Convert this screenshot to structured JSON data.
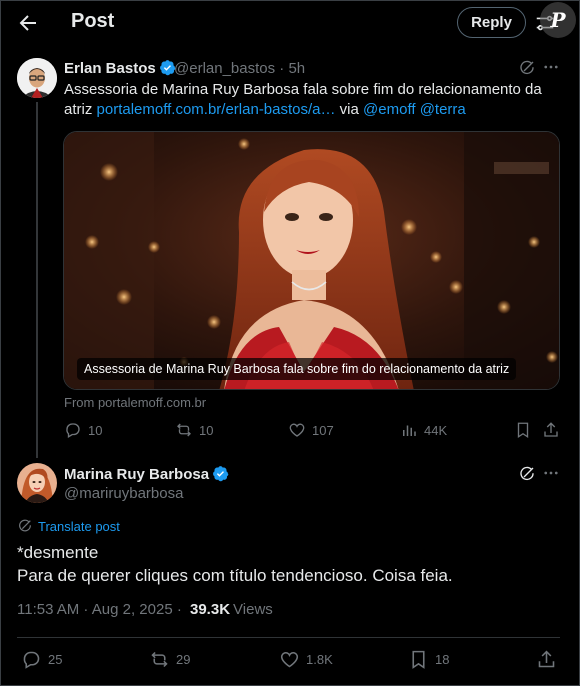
{
  "header": {
    "title": "Post",
    "reply_label": "Reply",
    "watermark": "P"
  },
  "quoted_tweet": {
    "author_name": "Erlan Bastos",
    "handle": "@erlan_bastos",
    "time": "· 5h",
    "text_before_link": "Assessoria de Marina Ruy Barbosa fala sobre fim do relacionamento da atriz ",
    "link": "portalemoff.com.br/erlan-bastos/a…",
    "via": " via ",
    "mention1": "@emoff",
    "space": " ",
    "mention2": "@terra",
    "media_caption": "Assessoria de Marina Ruy Barbosa fala sobre fim do relacionamento da atriz",
    "source": "From portalemoff.com.br",
    "replies": "10",
    "reposts": "10",
    "likes": "107",
    "views": "44K"
  },
  "main_tweet": {
    "author_name": "Marina Ruy Barbosa",
    "handle": "@mariruybarbosa",
    "translate_label": "Translate post",
    "line1": "*desmente",
    "line2": "Para de querer cliques com título tendencioso. Coisa feia.",
    "timestamp": "11:53 AM · Aug 2, 2025 · ",
    "views_count": "39.3K",
    "views_label": "Views",
    "replies": "25",
    "reposts": "29",
    "likes": "1.8K",
    "bookmarks": "18"
  },
  "colors": {
    "accent": "#1d9bf0",
    "text": "#e7e9ea",
    "muted": "#71767b",
    "background": "#000000"
  }
}
